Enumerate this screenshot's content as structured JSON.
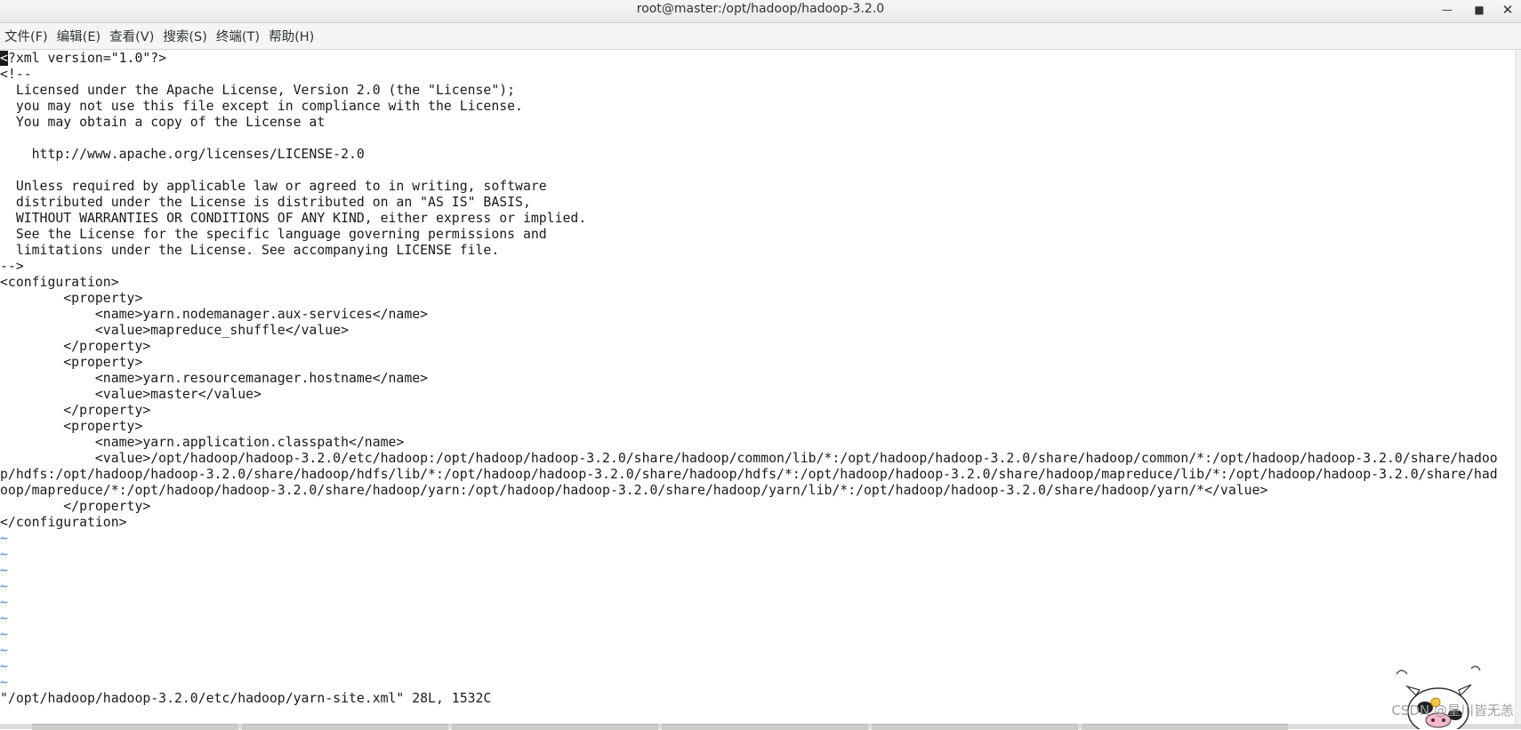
{
  "window": {
    "title": "root@master:/opt/hadoop/hadoop-3.2.0",
    "minimize_icon": "minimize-icon",
    "maximize_icon": "maximize-icon",
    "close_icon": "close-icon"
  },
  "menu": [
    {
      "label": "文件(F)"
    },
    {
      "label": "编辑(E)"
    },
    {
      "label": "查看(V)"
    },
    {
      "label": "搜索(S)"
    },
    {
      "label": "终端(T)"
    },
    {
      "label": "帮助(H)"
    }
  ],
  "editor": {
    "lines": [
      {
        "text": "?xml version=\"1.0\"?>"
      },
      {
        "text": "<!--"
      },
      {
        "text": "  Licensed under the Apache License, Version 2.0 (the \"License\");"
      },
      {
        "text": "  you may not use this file except in compliance with the License."
      },
      {
        "text": "  You may obtain a copy of the License at"
      },
      {
        "text": ""
      },
      {
        "text": "    http://www.apache.org/licenses/LICENSE-2.0"
      },
      {
        "text": ""
      },
      {
        "text": "  Unless required by applicable law or agreed to in writing, software"
      },
      {
        "text": "  distributed under the License is distributed on an \"AS IS\" BASIS,"
      },
      {
        "text": "  WITHOUT WARRANTIES OR CONDITIONS OF ANY KIND, either express or implied."
      },
      {
        "text": "  See the License for the specific language governing permissions and"
      },
      {
        "text": "  limitations under the License. See accompanying LICENSE file."
      },
      {
        "text": "-->"
      },
      {
        "text": "<configuration>"
      },
      {
        "text": "        <property>"
      },
      {
        "text": "            <name>yarn.nodemanager.aux-services</name>"
      },
      {
        "text": "            <value>mapreduce_shuffle</value>"
      },
      {
        "text": "        </property>"
      },
      {
        "text": "        <property>"
      },
      {
        "text": "            <name>yarn.resourcemanager.hostname</name>"
      },
      {
        "text": "            <value>master</value>"
      },
      {
        "text": "        </property>"
      },
      {
        "text": "        <property>"
      },
      {
        "text": "            <name>yarn.application.classpath</name>"
      },
      {
        "text": "            <value>/opt/hadoop/hadoop-3.2.0/etc/hadoop:/opt/hadoop/hadoop-3.2.0/share/hadoop/common/lib/*:/opt/hadoop/hadoop-3.2.0/share/hadoop/common/*:/opt/hadoop/hadoop-3.2.0/share/hadoo"
      },
      {
        "text": "p/hdfs:/opt/hadoop/hadoop-3.2.0/share/hadoop/hdfs/lib/*:/opt/hadoop/hadoop-3.2.0/share/hadoop/hdfs/*:/opt/hadoop/hadoop-3.2.0/share/hadoop/mapreduce/lib/*:/opt/hadoop/hadoop-3.2.0/share/had"
      },
      {
        "text": "oop/mapreduce/*:/opt/hadoop/hadoop-3.2.0/share/hadoop/yarn:/opt/hadoop/hadoop-3.2.0/share/hadoop/yarn/lib/*:/opt/hadoop/hadoop-3.2.0/share/hadoop/yarn/*</value>"
      },
      {
        "text": "        </property>"
      },
      {
        "text": "</configuration>"
      }
    ],
    "cursor_char": "<",
    "tilde": "~",
    "tilde_count": 10,
    "status_line": "\"/opt/hadoop/hadoop-3.2.0/etc/hadoop/yarn-site.xml\" 28L, 1532C"
  },
  "watermark": "CSDN @星川皆无恙",
  "colors": {
    "tilde": "#3d7fd6",
    "text": "#1a1a1a",
    "background": "#ffffff"
  }
}
